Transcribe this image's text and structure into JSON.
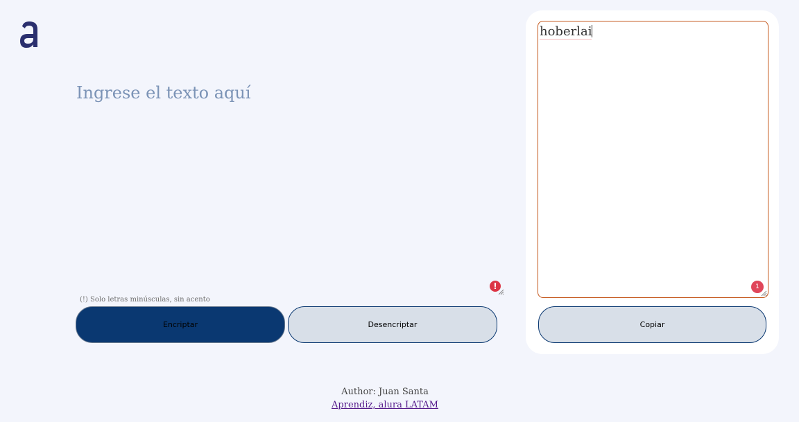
{
  "logo": {
    "icon": "alura-a-logo",
    "color": "#2a2f6e"
  },
  "input": {
    "placeholder": "Ingrese el texto aquí",
    "value": "",
    "warning_icon": "exclamation-icon",
    "hint": "(!) Solo letras minúsculas, sin acento"
  },
  "buttons": {
    "encrypt": "Encriptar",
    "decrypt": "Desencriptar",
    "copy": "Copiar"
  },
  "output": {
    "value": "hoberlai",
    "count_badge": "1"
  },
  "footer": {
    "author": "Author: Juan Santa",
    "link": "Aprendiz, alura LATAM"
  },
  "colors": {
    "background": "#f3f5fc",
    "primary": "#0a3871",
    "secondary": "#d8dfe8",
    "output_border": "#c4561a",
    "placeholder": "#7b93b6"
  }
}
